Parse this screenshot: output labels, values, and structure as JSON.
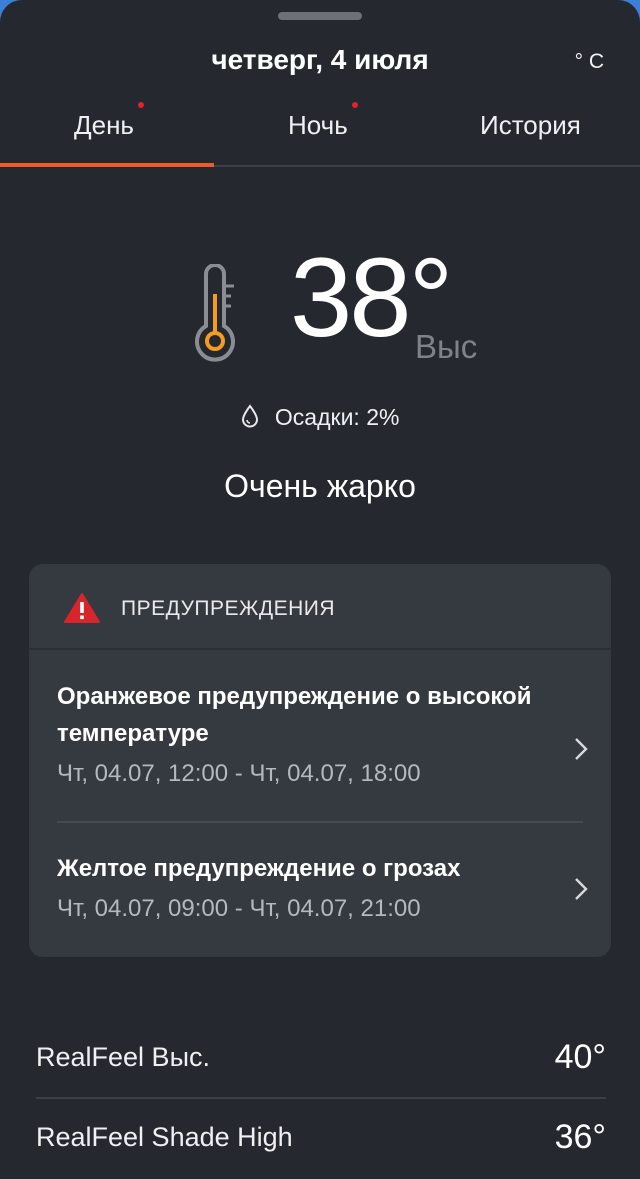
{
  "header": {
    "date": "четверг, 4 июля",
    "unit": "° C"
  },
  "tabs": [
    {
      "label": "День",
      "active": true,
      "has_dot": true
    },
    {
      "label": "Ночь",
      "active": false,
      "has_dot": true
    },
    {
      "label": "История",
      "active": false,
      "has_dot": false
    }
  ],
  "hero": {
    "temperature": "38°",
    "label": "Выс",
    "precipitation": "Осадки: 2%",
    "phrase": "Очень жарко",
    "icon": "thermometer-icon"
  },
  "alerts": {
    "title": "ПРЕДУПРЕЖДЕНИЯ",
    "items": [
      {
        "title": "Оранжевое предупреждение о высокой температуре",
        "time": "Чт, 04.07, 12:00 - Чт, 04.07, 18:00"
      },
      {
        "title": "Желтое предупреждение о грозах",
        "time": "Чт, 04.07, 09:00 - Чт, 04.07, 21:00"
      }
    ]
  },
  "realfeel": [
    {
      "label": "RealFeel Выс.",
      "value": "40°"
    },
    {
      "label": "RealFeel Shade High",
      "value": "36°"
    }
  ],
  "colors": {
    "background": "#25292f",
    "card": "#353a41",
    "accent": "#f05a28",
    "thermometer": "#f39c1f",
    "warning": "#d7262b"
  }
}
